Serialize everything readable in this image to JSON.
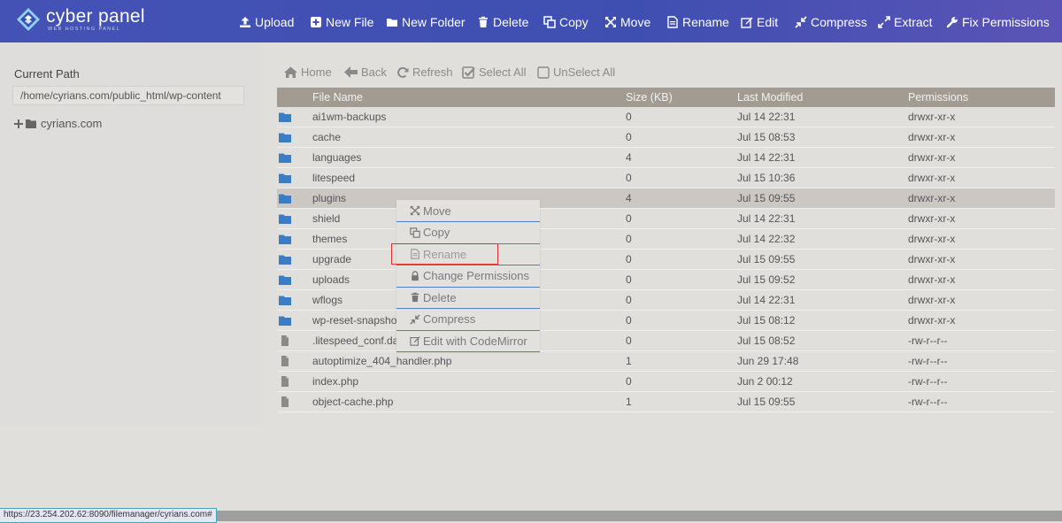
{
  "brand": {
    "title": "cyber panel",
    "subtitle": "WEB HOSTING PANEL"
  },
  "toolbar": [
    {
      "label": "Upload",
      "icon": "upload-icon"
    },
    {
      "label": "New File",
      "icon": "plus-square-icon"
    },
    {
      "label": "New Folder",
      "icon": "folder-icon"
    },
    {
      "label": "Delete",
      "icon": "trash-icon"
    },
    {
      "label": "Copy",
      "icon": "copy-icon"
    },
    {
      "label": "Move",
      "icon": "move-arrows-icon"
    },
    {
      "label": "Rename",
      "icon": "file-text-icon"
    },
    {
      "label": "Edit",
      "icon": "edit-icon"
    },
    {
      "label": "Compress",
      "icon": "compress-icon"
    },
    {
      "label": "Extract",
      "icon": "expand-icon"
    },
    {
      "label": "Fix Permissions",
      "icon": "wrench-icon"
    }
  ],
  "sidebar": {
    "title": "Current Path",
    "path_value": "/home/cyrians.com/public_html/wp-content",
    "tree_root": "cyrians.com"
  },
  "nav": {
    "home": "Home",
    "back": "Back",
    "refresh": "Refresh",
    "select_all": "Select All",
    "unselect_all": "UnSelect All"
  },
  "table": {
    "headers": {
      "name": "File Name",
      "size": "Size (KB)",
      "modified": "Last Modified",
      "perms": "Permissions"
    },
    "rows": [
      {
        "type": "folder",
        "name": "ai1wm-backups",
        "size": "0",
        "modified": "Jul 14 22:31",
        "perms": "drwxr-xr-x"
      },
      {
        "type": "folder",
        "name": "cache",
        "size": "0",
        "modified": "Jul 15 08:53",
        "perms": "drwxr-xr-x"
      },
      {
        "type": "folder",
        "name": "languages",
        "size": "4",
        "modified": "Jul 14 22:31",
        "perms": "drwxr-xr-x"
      },
      {
        "type": "folder",
        "name": "litespeed",
        "size": "0",
        "modified": "Jul 15 10:36",
        "perms": "drwxr-xr-x"
      },
      {
        "type": "folder",
        "name": "plugins",
        "size": "4",
        "modified": "Jul 15 09:55",
        "perms": "drwxr-xr-x",
        "selected": true
      },
      {
        "type": "folder",
        "name": "shield",
        "size": "0",
        "modified": "Jul 14 22:31",
        "perms": "drwxr-xr-x"
      },
      {
        "type": "folder",
        "name": "themes",
        "size": "0",
        "modified": "Jul 14 22:32",
        "perms": "drwxr-xr-x"
      },
      {
        "type": "folder",
        "name": "upgrade",
        "size": "0",
        "modified": "Jul 15 09:55",
        "perms": "drwxr-xr-x"
      },
      {
        "type": "folder",
        "name": "uploads",
        "size": "0",
        "modified": "Jul 15 09:52",
        "perms": "drwxr-xr-x"
      },
      {
        "type": "folder",
        "name": "wflogs",
        "size": "0",
        "modified": "Jul 14 22:31",
        "perms": "drwxr-xr-x"
      },
      {
        "type": "folder",
        "name": "wp-reset-snapshots",
        "size": "0",
        "modified": "Jul 15 08:12",
        "perms": "drwxr-xr-x"
      },
      {
        "type": "file",
        "name": ".litespeed_conf.dat",
        "size": "0",
        "modified": "Jul 15 08:52",
        "perms": "-rw-r--r--"
      },
      {
        "type": "file",
        "name": "autoptimize_404_handler.php",
        "size": "1",
        "modified": "Jun 29 17:48",
        "perms": "-rw-r--r--"
      },
      {
        "type": "file",
        "name": "index.php",
        "size": "0",
        "modified": "Jun 2 00:12",
        "perms": "-rw-r--r--"
      },
      {
        "type": "file",
        "name": "object-cache.php",
        "size": "1",
        "modified": "Jul 15 09:55",
        "perms": "-rw-r--r--"
      }
    ]
  },
  "context_menu": [
    {
      "label": "Move",
      "icon": "move-arrows-icon"
    },
    {
      "label": "Copy",
      "icon": "copy-icon"
    },
    {
      "label": "Rename",
      "icon": "file-text-icon",
      "highlighted": true
    },
    {
      "label": "Change Permissions",
      "icon": "lock-icon"
    },
    {
      "label": "Delete",
      "icon": "trash-icon"
    },
    {
      "label": "Compress",
      "icon": "compress-icon"
    },
    {
      "label": "Edit with CodeMirror",
      "icon": "edit-icon"
    }
  ],
  "status_url": "https://23.254.202.62:8090/filemanager/cyrians.com#",
  "colors": {
    "topbar": "#4452b5",
    "header_row": "#a19b92",
    "selected_row": "#cbc8c3",
    "folder_icon": "#3a7cc6",
    "menu_border": "#4d7fc4",
    "highlight_box": "#e0302a"
  }
}
